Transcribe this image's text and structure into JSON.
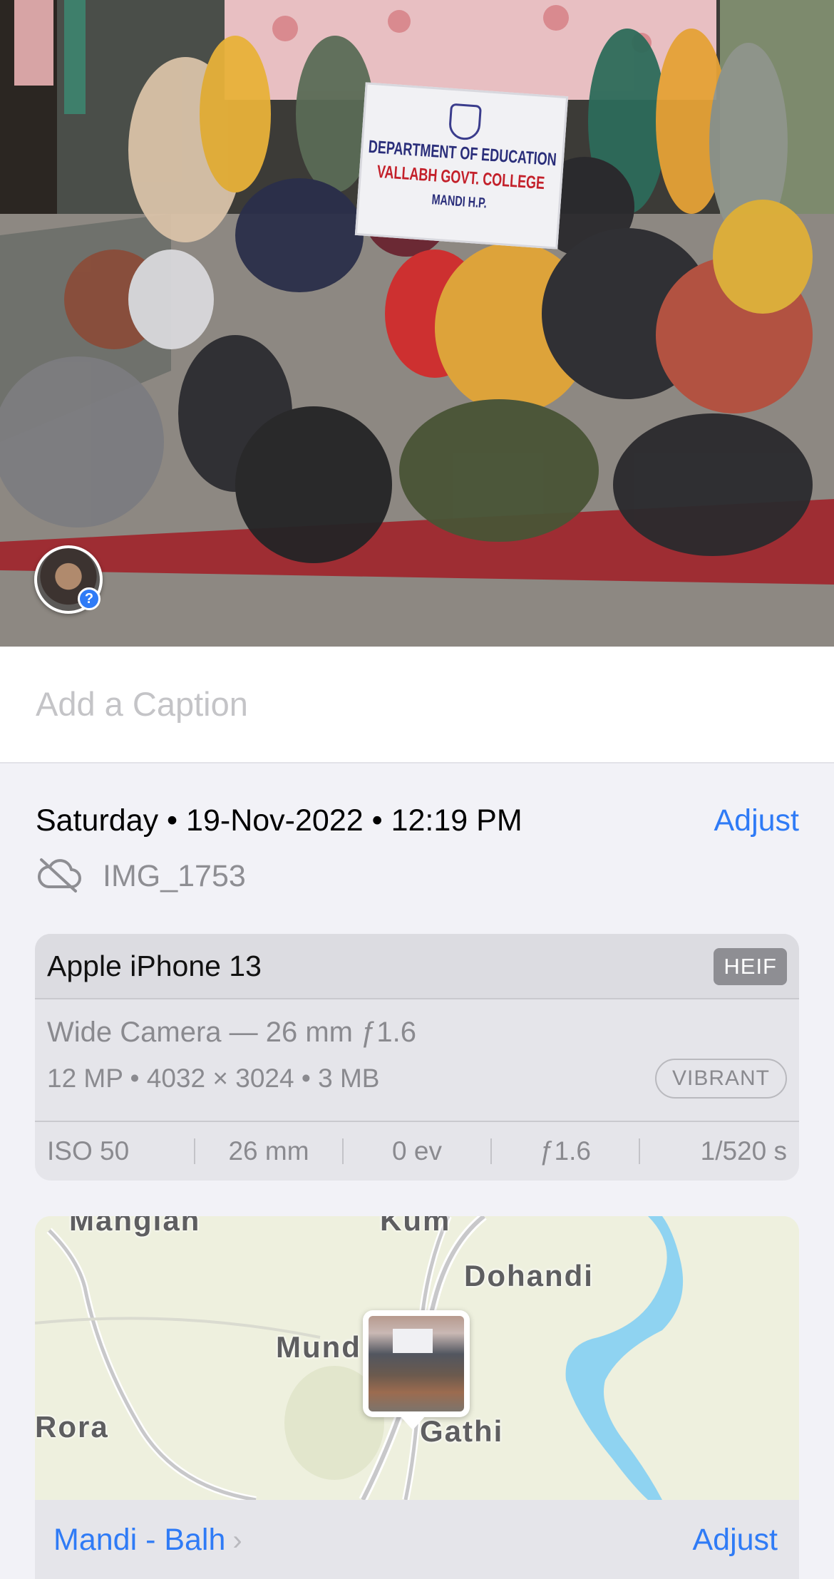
{
  "photo": {
    "banner_lines": [
      "DEPARTMENT OF EDUCATION",
      "VALLABH GOVT. COLLEGE",
      "MANDI H.P."
    ],
    "face_badge": "?"
  },
  "caption": {
    "placeholder": "Add a Caption"
  },
  "meta": {
    "datetime": "Saturday • 19-Nov-2022 • 12:19 PM",
    "adjust_label": "Adjust",
    "filename": "IMG_1753",
    "cloud_icon": "cloud-slash-icon"
  },
  "camera": {
    "model": "Apple iPhone 13",
    "format_badge": "HEIF",
    "lens": "Wide Camera — 26 mm ƒ1.6",
    "specs": "12 MP  •  4032 × 3024  •  3 MB",
    "style_badge": "VIBRANT",
    "exif": [
      "ISO 50",
      "26 mm",
      "0 ev",
      "ƒ1.6",
      "1/520 s"
    ]
  },
  "map": {
    "labels": {
      "manglan": "Manglan",
      "kum": "Kum",
      "dohandi": "Dohandi",
      "mund": "Mund",
      "rora": "Rora",
      "gathi": "Gathi"
    },
    "place": "Mandi - Balh",
    "adjust_label": "Adjust",
    "colors": {
      "land": "#eef0de",
      "water": "#8fd3f1",
      "road": "#c8c8ca",
      "accent": "#2f7bf6"
    }
  }
}
